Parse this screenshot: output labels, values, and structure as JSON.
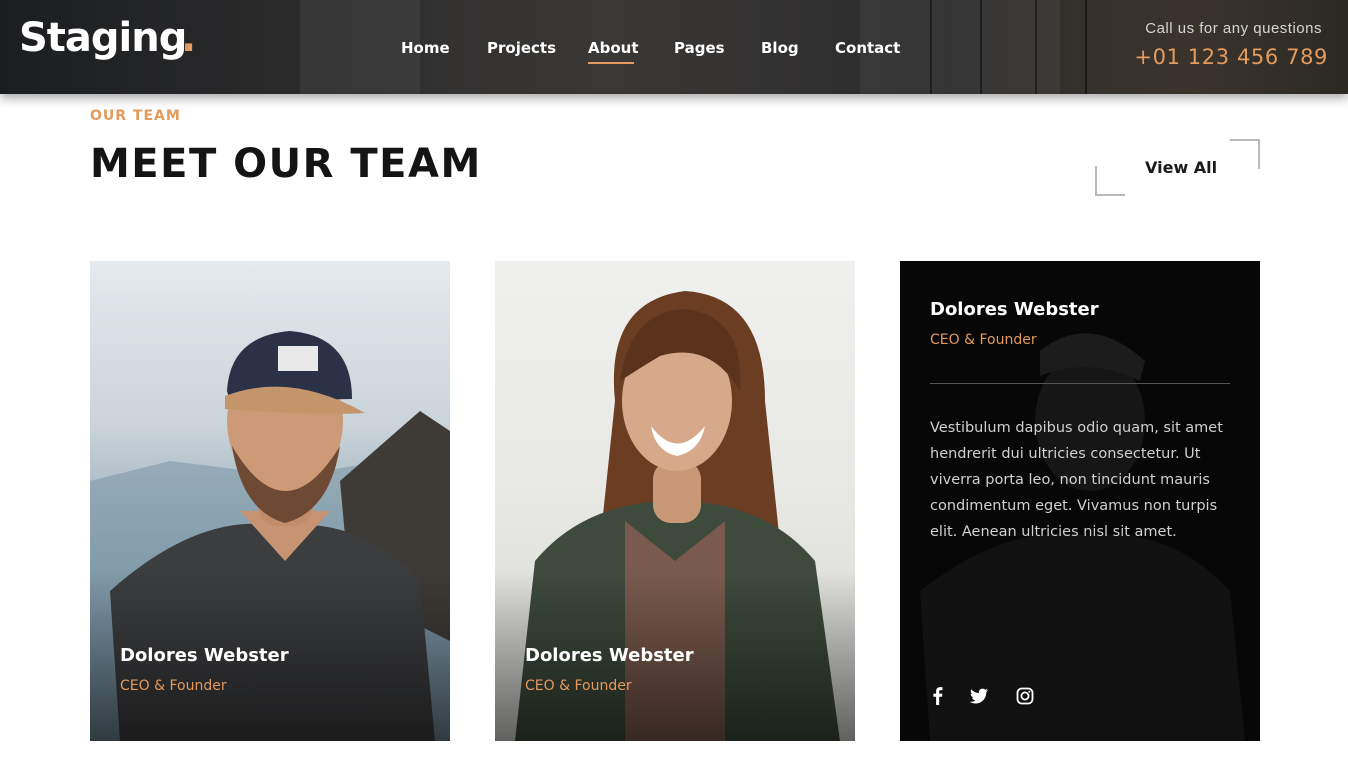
{
  "header": {
    "logo_text": "Staging",
    "logo_dot": ".",
    "nav": [
      "Home",
      "Projects",
      "About",
      "Pages",
      "Blog",
      "Contact"
    ],
    "active_nav": "About",
    "call_label": "Call us for any questions",
    "phone": "+01 123 456 789"
  },
  "section": {
    "eyebrow": "OUR TEAM",
    "title": "MEET OUR TEAM",
    "view_all": "View All"
  },
  "team": [
    {
      "name": "Dolores Webster",
      "role": "CEO & Founder"
    },
    {
      "name": "Dolores Webster",
      "role": "CEO & Founder"
    },
    {
      "name": "Dolores Webster",
      "role": "CEO & Founder",
      "bio": "Vestibulum dapibus odio quam, sit amet hendrerit dui ultricies consectetur. Ut viverra porta leo, non tincidunt mauris condimentum eget. Vivamus non turpis elit. Aenean ultricies nisl sit amet.",
      "social": [
        "facebook-icon",
        "twitter-icon",
        "instagram-icon"
      ]
    }
  ],
  "colors": {
    "accent": "#e39a5c",
    "dark": "#141414",
    "card_dark": "#070707"
  }
}
